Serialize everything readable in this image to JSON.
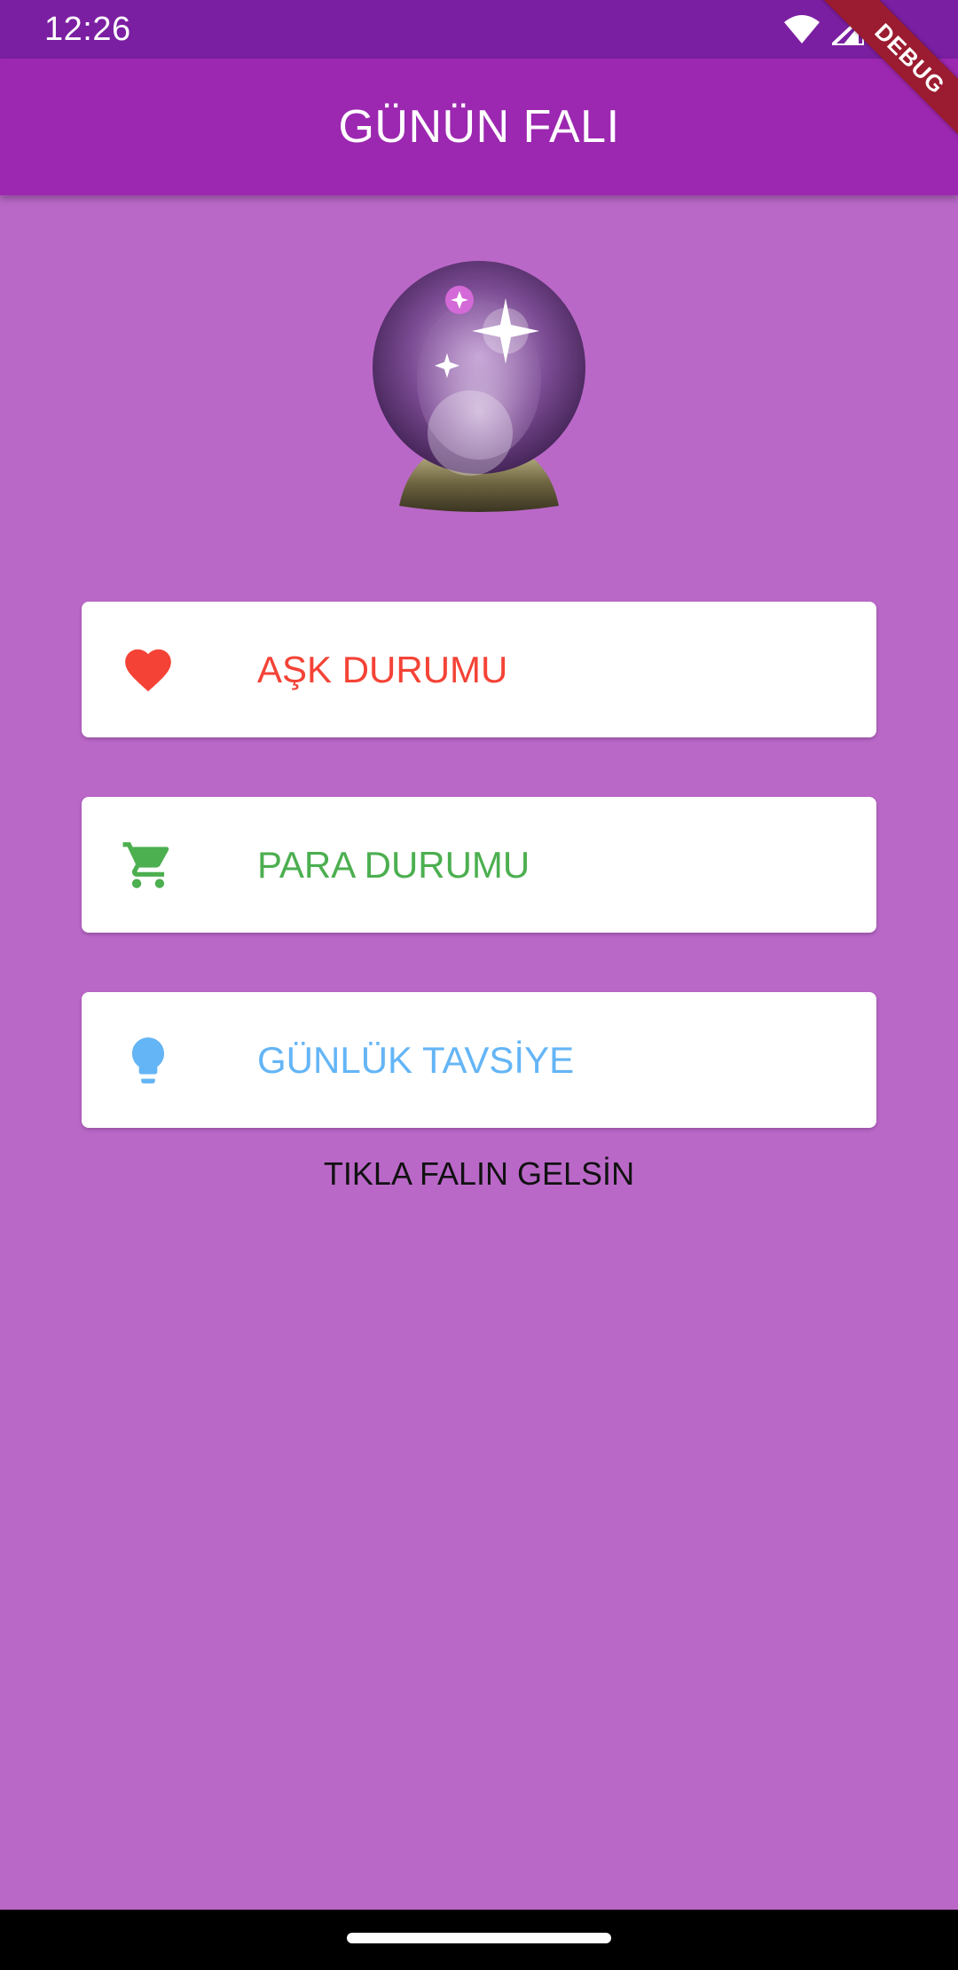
{
  "status_bar": {
    "time": "12:26",
    "icons": [
      "wifi-icon",
      "signal-icon",
      "battery-icon"
    ]
  },
  "debug_banner": {
    "label": "DEBUG",
    "color": "#9b1b30"
  },
  "app_bar": {
    "title": "GÜNÜN FALI",
    "color": "#9c27b0"
  },
  "theme": {
    "background": "#ba68c8",
    "status_bar_color": "#7b1fa2"
  },
  "hero": {
    "icon": "crystal-ball-icon"
  },
  "cards": [
    {
      "label": "AŞK DURUMU",
      "icon": "heart-icon",
      "color": "#f44336"
    },
    {
      "label": "PARA DURUMU",
      "icon": "shopping-cart-icon",
      "color": "#4caf50"
    },
    {
      "label": "GÜNLÜK TAVSİYE",
      "icon": "lightbulb-icon",
      "color": "#64b5f6"
    }
  ],
  "hint": {
    "text": "TIKLA FALIN GELSİN"
  }
}
